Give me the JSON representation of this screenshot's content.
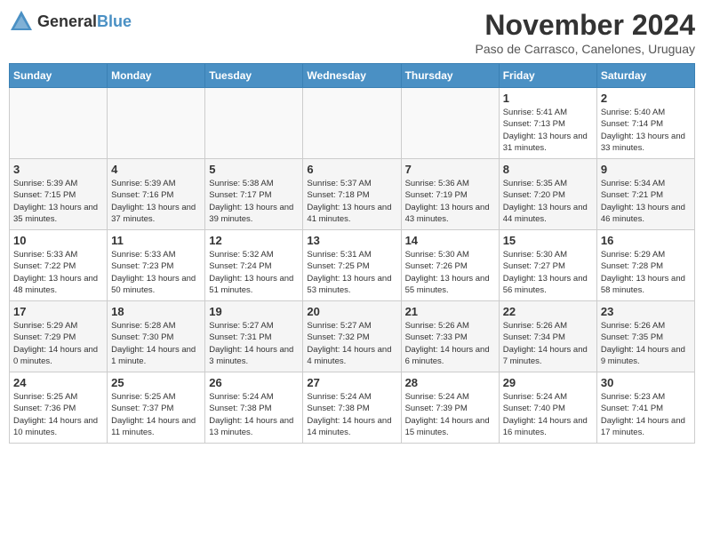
{
  "logo": {
    "general": "General",
    "blue": "Blue"
  },
  "header": {
    "month": "November 2024",
    "location": "Paso de Carrasco, Canelones, Uruguay"
  },
  "weekdays": [
    "Sunday",
    "Monday",
    "Tuesday",
    "Wednesday",
    "Thursday",
    "Friday",
    "Saturday"
  ],
  "weeks": [
    [
      {
        "day": "",
        "info": ""
      },
      {
        "day": "",
        "info": ""
      },
      {
        "day": "",
        "info": ""
      },
      {
        "day": "",
        "info": ""
      },
      {
        "day": "",
        "info": ""
      },
      {
        "day": "1",
        "info": "Sunrise: 5:41 AM\nSunset: 7:13 PM\nDaylight: 13 hours and 31 minutes."
      },
      {
        "day": "2",
        "info": "Sunrise: 5:40 AM\nSunset: 7:14 PM\nDaylight: 13 hours and 33 minutes."
      }
    ],
    [
      {
        "day": "3",
        "info": "Sunrise: 5:39 AM\nSunset: 7:15 PM\nDaylight: 13 hours and 35 minutes."
      },
      {
        "day": "4",
        "info": "Sunrise: 5:39 AM\nSunset: 7:16 PM\nDaylight: 13 hours and 37 minutes."
      },
      {
        "day": "5",
        "info": "Sunrise: 5:38 AM\nSunset: 7:17 PM\nDaylight: 13 hours and 39 minutes."
      },
      {
        "day": "6",
        "info": "Sunrise: 5:37 AM\nSunset: 7:18 PM\nDaylight: 13 hours and 41 minutes."
      },
      {
        "day": "7",
        "info": "Sunrise: 5:36 AM\nSunset: 7:19 PM\nDaylight: 13 hours and 43 minutes."
      },
      {
        "day": "8",
        "info": "Sunrise: 5:35 AM\nSunset: 7:20 PM\nDaylight: 13 hours and 44 minutes."
      },
      {
        "day": "9",
        "info": "Sunrise: 5:34 AM\nSunset: 7:21 PM\nDaylight: 13 hours and 46 minutes."
      }
    ],
    [
      {
        "day": "10",
        "info": "Sunrise: 5:33 AM\nSunset: 7:22 PM\nDaylight: 13 hours and 48 minutes."
      },
      {
        "day": "11",
        "info": "Sunrise: 5:33 AM\nSunset: 7:23 PM\nDaylight: 13 hours and 50 minutes."
      },
      {
        "day": "12",
        "info": "Sunrise: 5:32 AM\nSunset: 7:24 PM\nDaylight: 13 hours and 51 minutes."
      },
      {
        "day": "13",
        "info": "Sunrise: 5:31 AM\nSunset: 7:25 PM\nDaylight: 13 hours and 53 minutes."
      },
      {
        "day": "14",
        "info": "Sunrise: 5:30 AM\nSunset: 7:26 PM\nDaylight: 13 hours and 55 minutes."
      },
      {
        "day": "15",
        "info": "Sunrise: 5:30 AM\nSunset: 7:27 PM\nDaylight: 13 hours and 56 minutes."
      },
      {
        "day": "16",
        "info": "Sunrise: 5:29 AM\nSunset: 7:28 PM\nDaylight: 13 hours and 58 minutes."
      }
    ],
    [
      {
        "day": "17",
        "info": "Sunrise: 5:29 AM\nSunset: 7:29 PM\nDaylight: 14 hours and 0 minutes."
      },
      {
        "day": "18",
        "info": "Sunrise: 5:28 AM\nSunset: 7:30 PM\nDaylight: 14 hours and 1 minute."
      },
      {
        "day": "19",
        "info": "Sunrise: 5:27 AM\nSunset: 7:31 PM\nDaylight: 14 hours and 3 minutes."
      },
      {
        "day": "20",
        "info": "Sunrise: 5:27 AM\nSunset: 7:32 PM\nDaylight: 14 hours and 4 minutes."
      },
      {
        "day": "21",
        "info": "Sunrise: 5:26 AM\nSunset: 7:33 PM\nDaylight: 14 hours and 6 minutes."
      },
      {
        "day": "22",
        "info": "Sunrise: 5:26 AM\nSunset: 7:34 PM\nDaylight: 14 hours and 7 minutes."
      },
      {
        "day": "23",
        "info": "Sunrise: 5:26 AM\nSunset: 7:35 PM\nDaylight: 14 hours and 9 minutes."
      }
    ],
    [
      {
        "day": "24",
        "info": "Sunrise: 5:25 AM\nSunset: 7:36 PM\nDaylight: 14 hours and 10 minutes."
      },
      {
        "day": "25",
        "info": "Sunrise: 5:25 AM\nSunset: 7:37 PM\nDaylight: 14 hours and 11 minutes."
      },
      {
        "day": "26",
        "info": "Sunrise: 5:24 AM\nSunset: 7:38 PM\nDaylight: 14 hours and 13 minutes."
      },
      {
        "day": "27",
        "info": "Sunrise: 5:24 AM\nSunset: 7:38 PM\nDaylight: 14 hours and 14 minutes."
      },
      {
        "day": "28",
        "info": "Sunrise: 5:24 AM\nSunset: 7:39 PM\nDaylight: 14 hours and 15 minutes."
      },
      {
        "day": "29",
        "info": "Sunrise: 5:24 AM\nSunset: 7:40 PM\nDaylight: 14 hours and 16 minutes."
      },
      {
        "day": "30",
        "info": "Sunrise: 5:23 AM\nSunset: 7:41 PM\nDaylight: 14 hours and 17 minutes."
      }
    ]
  ]
}
